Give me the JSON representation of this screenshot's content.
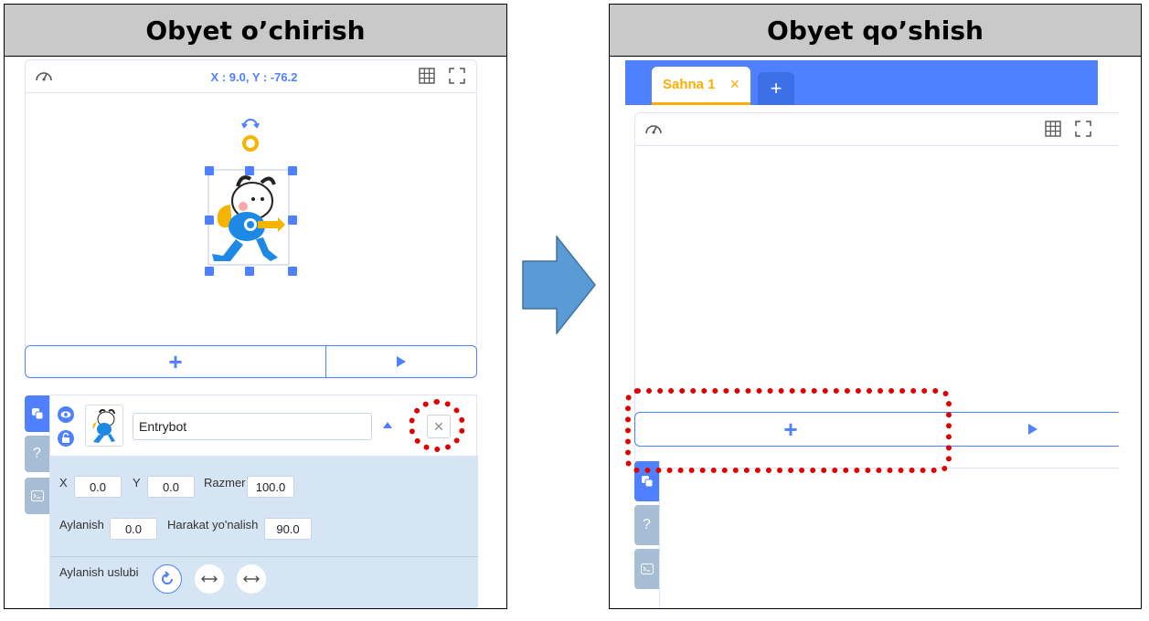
{
  "left_panel": {
    "title": "Obyet o’chirish",
    "stage": {
      "coords_label": "X : 9.0, Y : -76.2",
      "add_button_label": "+",
      "speed_icon": "speedometer-icon",
      "grid_icon": "grid-icon",
      "fullscreen_icon": "fullscreen-icon"
    },
    "object": {
      "name": "Entrybot",
      "delete_label": "×",
      "x_label": "X",
      "x_value": "0.0",
      "y_label": "Y",
      "y_value": "0.0",
      "size_label": "Razmer",
      "size_value": "100.0",
      "rotation_label": "Aylanish",
      "rotation_value": "0.0",
      "direction_label": "Harakat yo'nalish",
      "direction_value": "90.0",
      "rotation_style_label": "Aylanish uslubi"
    },
    "side_tabs": {
      "help_label": "?"
    }
  },
  "right_panel": {
    "title": "Obyet qo’shish",
    "scene_tab_label": "Sahna 1",
    "scene_tab_close": "×",
    "add_scene_label": "+",
    "add_object_label": "+",
    "side_tabs": {
      "help_label": "?"
    }
  },
  "colors": {
    "accent": "#4f80ff",
    "scene_tab_text": "#ffae00",
    "highlight_red": "#e00000",
    "arrow": "#5b9bd5"
  }
}
